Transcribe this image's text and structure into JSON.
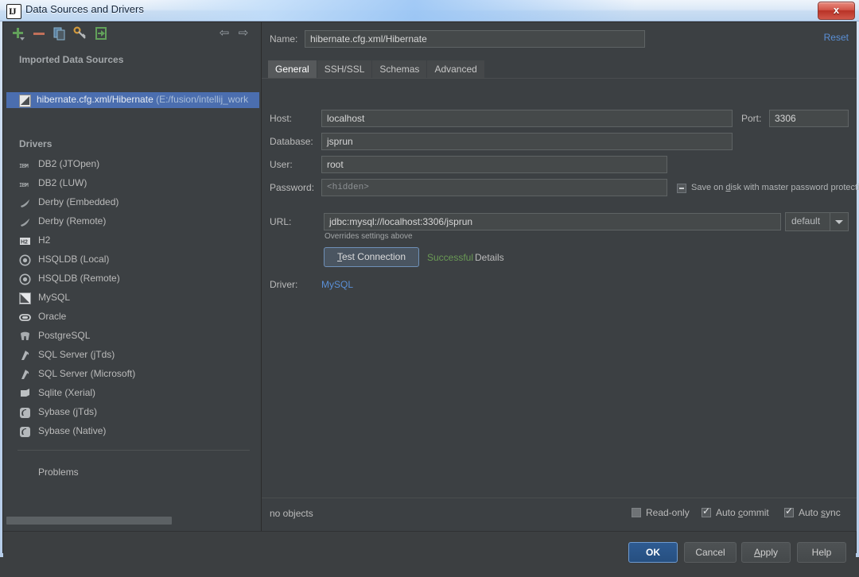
{
  "window": {
    "title": "Data Sources and Drivers",
    "app_icon": "intellij-idea-icon",
    "close_label": "x"
  },
  "sidebar": {
    "toolbar": [
      {
        "name": "add-icon",
        "label": "+"
      },
      {
        "name": "remove-icon",
        "label": "−"
      },
      {
        "name": "copy-icon",
        "label": "copy"
      },
      {
        "name": "driver-properties-icon",
        "label": "wrench"
      },
      {
        "name": "import-icon",
        "label": "import"
      }
    ],
    "nav_back": "⇦",
    "nav_forward": "⇨",
    "imported_header": "Imported Data Sources",
    "selected_data_source": {
      "name": "hibernate.cfg.xml/Hibernate",
      "path": "(E:/fusion/intellij_work",
      "icon": "mysql-icon"
    },
    "drivers_header": "Drivers",
    "drivers": [
      {
        "label": "DB2 (JTOpen)",
        "icon": "ibm-db2-icon"
      },
      {
        "label": "DB2 (LUW)",
        "icon": "ibm-db2-icon"
      },
      {
        "label": "Derby (Embedded)",
        "icon": "derby-icon"
      },
      {
        "label": "Derby (Remote)",
        "icon": "derby-icon"
      },
      {
        "label": "H2",
        "icon": "h2-icon"
      },
      {
        "label": "HSQLDB (Local)",
        "icon": "hsqldb-icon"
      },
      {
        "label": "HSQLDB (Remote)",
        "icon": "hsqldb-icon"
      },
      {
        "label": "MySQL",
        "icon": "mysql-icon"
      },
      {
        "label": "Oracle",
        "icon": "oracle-icon"
      },
      {
        "label": "PostgreSQL",
        "icon": "postgresql-icon"
      },
      {
        "label": "SQL Server (jTds)",
        "icon": "sqlserver-icon"
      },
      {
        "label": "SQL Server (Microsoft)",
        "icon": "sqlserver-icon"
      },
      {
        "label": "Sqlite (Xerial)",
        "icon": "sqlite-icon"
      },
      {
        "label": "Sybase (jTds)",
        "icon": "sybase-icon"
      },
      {
        "label": "Sybase (Native)",
        "icon": "sybase-icon"
      }
    ],
    "problems_label": "Problems"
  },
  "details": {
    "name_label": "Name:",
    "name_value": "hibernate.cfg.xml/Hibernate",
    "reset_label": "Reset",
    "tabs": [
      {
        "label": "General",
        "active": true
      },
      {
        "label": "SSH/SSL",
        "active": false
      },
      {
        "label": "Schemas",
        "active": false
      },
      {
        "label": "Advanced",
        "active": false
      }
    ],
    "fields": {
      "host_label": "Host:",
      "host_value": "localhost",
      "port_label": "Port:",
      "port_value": "3306",
      "database_label": "Database:",
      "database_value": "jsprun",
      "user_label": "User:",
      "user_value": "root",
      "password_label": "Password:",
      "password_value": "<hidden>",
      "url_label": "URL:",
      "url_value": "jdbc:mysql://localhost:3306/jsprun",
      "url_note": "Overrides settings above",
      "driver_label": "Driver:",
      "driver_value": "MySQL"
    },
    "save_on_disk": {
      "label_pre": "Save on ",
      "label_accel": "d",
      "label_post": "isk with master password protection",
      "state": "indeterminate"
    },
    "charset_combo": {
      "value": "default",
      "icon": "chevron-down-icon"
    },
    "test_connection": {
      "accel": "T",
      "label_rest": "est Connection",
      "status": "Successful",
      "details_label": "Details"
    },
    "status_bar": {
      "objects_label": "no objects",
      "checkboxes": [
        {
          "label_pre": "Read-only",
          "accel": "",
          "label_post": "",
          "checked": false,
          "name": "read-only"
        },
        {
          "label_pre": "Auto ",
          "accel": "c",
          "label_post": "ommit",
          "checked": true,
          "name": "auto-commit"
        },
        {
          "label_pre": "Auto ",
          "accel": "s",
          "label_post": "ync",
          "checked": true,
          "name": "auto-sync"
        }
      ]
    }
  },
  "footer": {
    "ok": "OK",
    "cancel": "Cancel",
    "apply_pre": "",
    "apply_accel": "A",
    "apply_post": "pply",
    "help": "Help"
  },
  "colors": {
    "panel_bg": "#3c4043",
    "selection_blue": "#4b6eaf",
    "link_blue": "#5a8fd6",
    "success_green": "#6a9a55",
    "field_bg": "#45494a"
  }
}
